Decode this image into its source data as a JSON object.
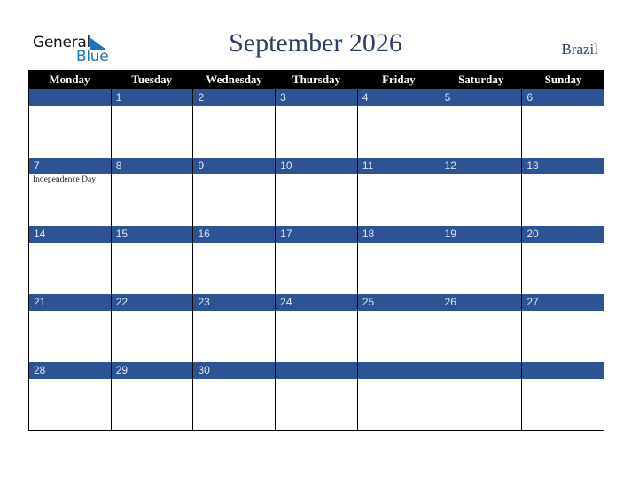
{
  "logo": {
    "line1": "General",
    "line2": "Blue",
    "accent_color": "#1a73c0"
  },
  "title": "September 2026",
  "country": "Brazil",
  "colors": {
    "header_bg": "#000000",
    "date_bar": "#2d5394",
    "title": "#2b3f66"
  },
  "weekdays": [
    "Monday",
    "Tuesday",
    "Wednesday",
    "Thursday",
    "Friday",
    "Saturday",
    "Sunday"
  ],
  "weeks": [
    [
      {
        "d": ""
      },
      {
        "d": "1"
      },
      {
        "d": "2"
      },
      {
        "d": "3"
      },
      {
        "d": "4"
      },
      {
        "d": "5"
      },
      {
        "d": "6"
      }
    ],
    [
      {
        "d": "7",
        "event": "Independence Day"
      },
      {
        "d": "8"
      },
      {
        "d": "9"
      },
      {
        "d": "10"
      },
      {
        "d": "11"
      },
      {
        "d": "12"
      },
      {
        "d": "13"
      }
    ],
    [
      {
        "d": "14"
      },
      {
        "d": "15"
      },
      {
        "d": "16"
      },
      {
        "d": "17"
      },
      {
        "d": "18"
      },
      {
        "d": "19"
      },
      {
        "d": "20"
      }
    ],
    [
      {
        "d": "21"
      },
      {
        "d": "22"
      },
      {
        "d": "23"
      },
      {
        "d": "24"
      },
      {
        "d": "25"
      },
      {
        "d": "26"
      },
      {
        "d": "27"
      }
    ],
    [
      {
        "d": "28"
      },
      {
        "d": "29"
      },
      {
        "d": "30"
      },
      {
        "d": ""
      },
      {
        "d": ""
      },
      {
        "d": ""
      },
      {
        "d": ""
      }
    ]
  ]
}
